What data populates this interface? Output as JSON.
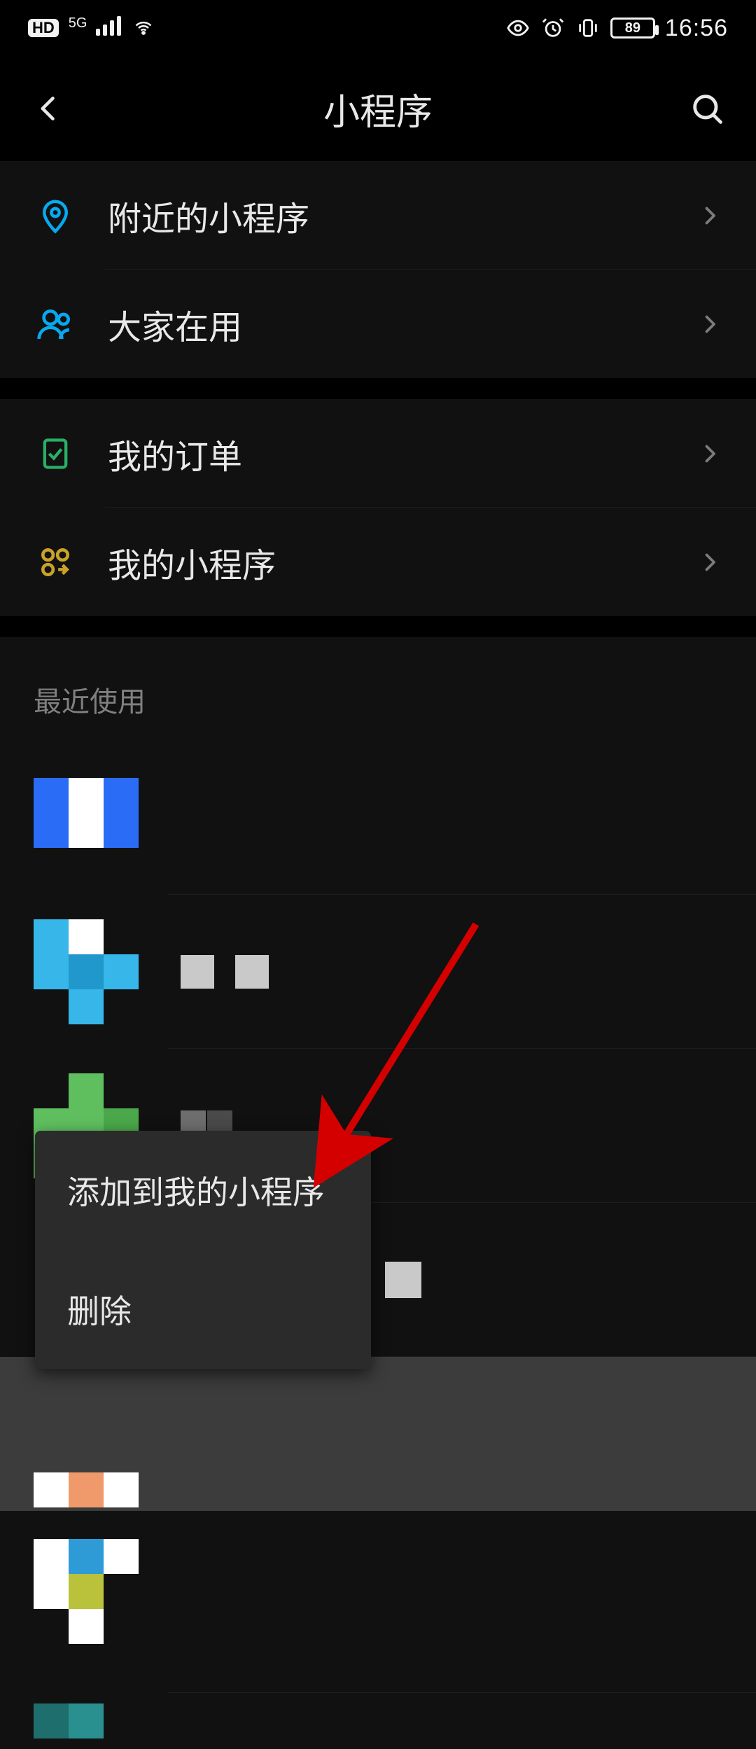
{
  "status": {
    "hd": "HD",
    "network_gen": "5G",
    "battery_pct": "89",
    "time": "16:56"
  },
  "header": {
    "title": "小程序"
  },
  "menu": {
    "nearby": "附近的小程序",
    "everyone_using": "大家在用",
    "my_orders": "我的订单",
    "my_miniprograms": "我的小程序"
  },
  "recent": {
    "section_title": "最近使用"
  },
  "context_menu": {
    "add_label": "添加到我的小程序",
    "delete_label": "删除"
  },
  "colors": {
    "accent_blue": "#07a9f0",
    "accent_green": "#2aae67",
    "accent_yellow": "#c9a227"
  }
}
